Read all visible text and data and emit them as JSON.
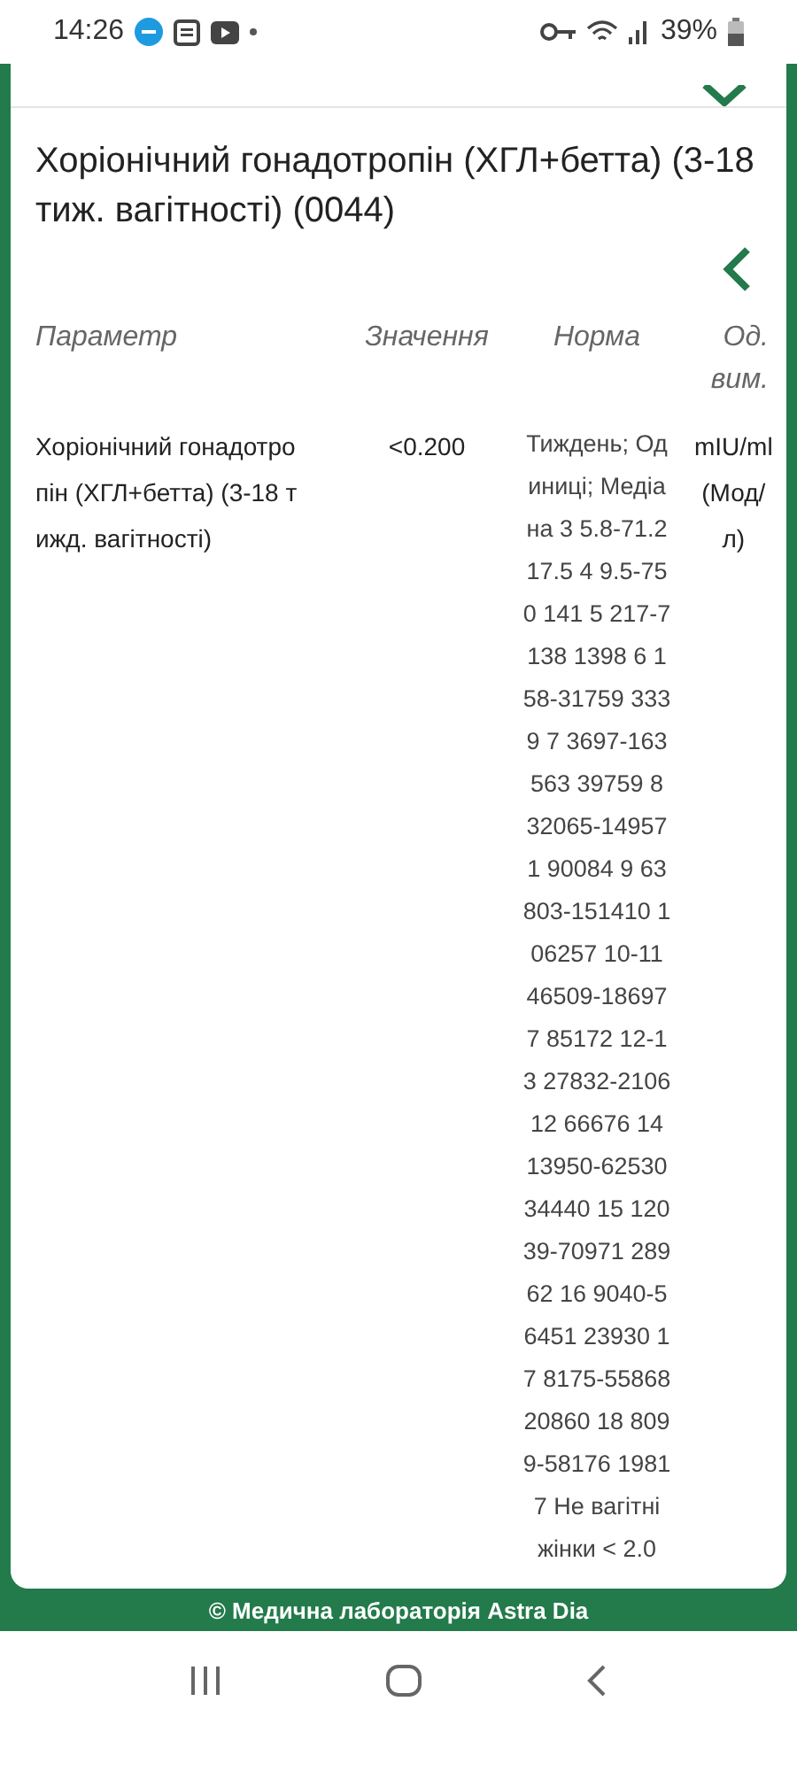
{
  "status_bar": {
    "time": "14:26",
    "battery": "39%"
  },
  "test": {
    "title": "Хоріонічний гонадотропін (ХГЛ+бетта) (3-18 тиж. вагітності) (0044)"
  },
  "table": {
    "columns": [
      "Параметр",
      "Значення",
      "Норма",
      "Од.\nвим."
    ],
    "rows": [
      {
        "parameter": "Хоріонічний гонадотро\nпін (ХГЛ+бетта) (3-18 т\nижд. вагітності)",
        "value": "<0.200",
        "norm": "Тиждень; Од\nиниці; Медіа\nна 3 5.8-71.2\n17.5 4 9.5-75\n0 141 5 217-7\n138 1398 6 1\n58-31759 333\n9 7 3697-163\n563 39759 8\n32065-14957\n1 90084 9 63\n803-151410 1\n06257 10-11\n46509-18697\n7 85172 12-1\n3 27832-2106\n12 66676 14\n13950-62530\n34440 15 120\n39-70971 289\n62 16 9040-5\n6451 23930 1\n7 8175-55868\n20860 18 809\n9-58176 1981\n7 Не вагітні\nжінки < 2.0",
        "unit": "mIU/ml\n(Мод/\nл)"
      }
    ]
  },
  "footer": "© Медична лабораторія Astra Dia"
}
